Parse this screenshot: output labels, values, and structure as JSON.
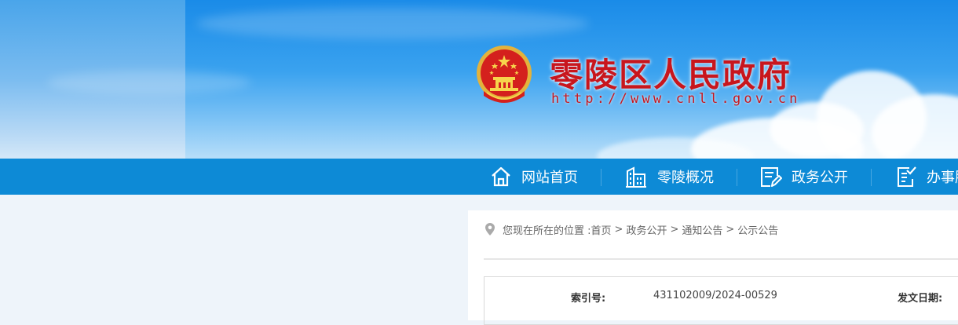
{
  "header": {
    "title": "零陵区人民政府",
    "url": "http://www.cnll.gov.cn"
  },
  "nav": {
    "items": [
      {
        "label": "网站首页",
        "icon": "home-icon"
      },
      {
        "label": "零陵概况",
        "icon": "building-icon"
      },
      {
        "label": "政务公开",
        "icon": "document-edit-icon"
      },
      {
        "label": "办事服务",
        "icon": "checklist-icon"
      }
    ]
  },
  "breadcrumb": {
    "prefix": "您现在所在的位置 : ",
    "items": [
      "首页",
      "政务公开",
      "通知公告",
      "公示公告"
    ],
    "separator": ">"
  },
  "info": {
    "index_label": "索引号:",
    "index_value": "431102009/2024-00529",
    "date_label": "发文日期:"
  },
  "colors": {
    "brand_red": "#c8161d",
    "nav_blue": "#0d8ad6"
  }
}
